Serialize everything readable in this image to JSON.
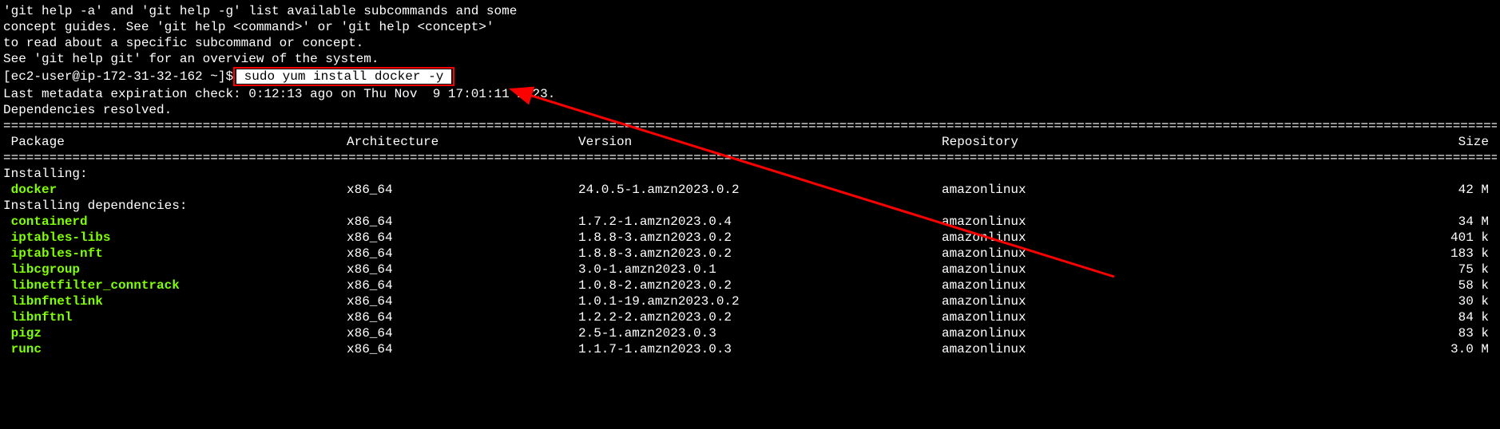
{
  "help_lines": [
    "'git help -a' and 'git help -g' list available subcommands and some",
    "concept guides. See 'git help <command>' or 'git help <concept>'",
    "to read about a specific subcommand or concept.",
    "See 'git help git' for an overview of the system."
  ],
  "prompt": "[ec2-user@ip-172-31-32-162 ~]$",
  "command": " sudo yum install docker -y ",
  "post_command": [
    "Last metadata expiration check: 0:12:13 ago on Thu Nov  9 17:01:11 2023.",
    "Dependencies resolved."
  ],
  "headers": {
    "package": " Package",
    "arch": "Architecture",
    "version": "Version",
    "repo": "Repository",
    "size": "Size"
  },
  "installing_label": "Installing:",
  "installing_deps_label": "Installing dependencies:",
  "packages": {
    "main": [
      {
        "name": " docker",
        "arch": "x86_64",
        "version": "24.0.5-1.amzn2023.0.2",
        "repo": "amazonlinux",
        "size": "42 M"
      }
    ],
    "deps": [
      {
        "name": " containerd",
        "arch": "x86_64",
        "version": "1.7.2-1.amzn2023.0.4",
        "repo": "amazonlinux",
        "size": "34 M"
      },
      {
        "name": " iptables-libs",
        "arch": "x86_64",
        "version": "1.8.8-3.amzn2023.0.2",
        "repo": "amazonlinux",
        "size": "401 k"
      },
      {
        "name": " iptables-nft",
        "arch": "x86_64",
        "version": "1.8.8-3.amzn2023.0.2",
        "repo": "amazonlinux",
        "size": "183 k"
      },
      {
        "name": " libcgroup",
        "arch": "x86_64",
        "version": "3.0-1.amzn2023.0.1",
        "repo": "amazonlinux",
        "size": "75 k"
      },
      {
        "name": " libnetfilter_conntrack",
        "arch": "x86_64",
        "version": "1.0.8-2.amzn2023.0.2",
        "repo": "amazonlinux",
        "size": "58 k"
      },
      {
        "name": " libnfnetlink",
        "arch": "x86_64",
        "version": "1.0.1-19.amzn2023.0.2",
        "repo": "amazonlinux",
        "size": "30 k"
      },
      {
        "name": " libnftnl",
        "arch": "x86_64",
        "version": "1.2.2-2.amzn2023.0.2",
        "repo": "amazonlinux",
        "size": "84 k"
      },
      {
        "name": " pigz",
        "arch": "x86_64",
        "version": "2.5-1.amzn2023.0.3",
        "repo": "amazonlinux",
        "size": "83 k"
      },
      {
        "name": " runc",
        "arch": "x86_64",
        "version": "1.1.7-1.amzn2023.0.3",
        "repo": "amazonlinux",
        "size": "3.0 M"
      }
    ]
  }
}
